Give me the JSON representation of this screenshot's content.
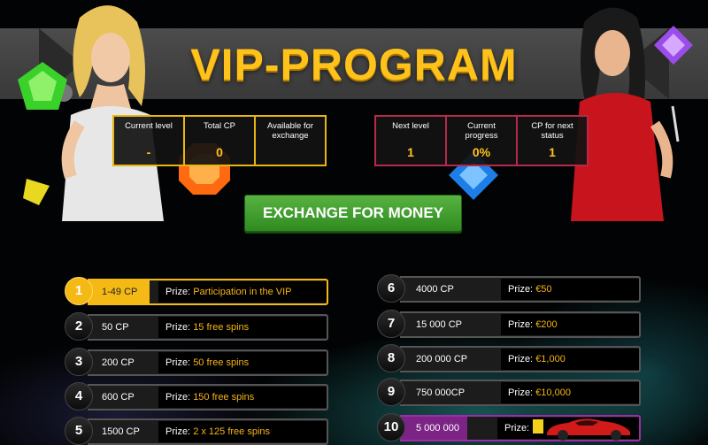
{
  "page": {
    "title": "VIP-PROGRAM",
    "exchange_button": "EXCHANGE FOR MONEY"
  },
  "stats_left": [
    {
      "label": "Current level",
      "value": "-"
    },
    {
      "label": "Total CP",
      "value": "0"
    },
    {
      "label": "Available for exchange",
      "value": ""
    }
  ],
  "stats_right": [
    {
      "label": "Next level",
      "value": "1"
    },
    {
      "label": "Current progress",
      "value": "0%"
    },
    {
      "label": "CP for next status",
      "value": "1"
    }
  ],
  "prize_label": "Prize:",
  "tiers_left": [
    {
      "num": "1",
      "cp": "1-49 CP",
      "prize": "Participation in the VIP"
    },
    {
      "num": "2",
      "cp": "50 CP",
      "prize": "15 free spins"
    },
    {
      "num": "3",
      "cp": "200 CP",
      "prize": "50 free spins"
    },
    {
      "num": "4",
      "cp": "600 CP",
      "prize": "150 free spins"
    },
    {
      "num": "5",
      "cp": "1500 CP",
      "prize": "2 x 125 free spins"
    }
  ],
  "tiers_right": [
    {
      "num": "6",
      "cp": "4000 CP",
      "prize": "€50"
    },
    {
      "num": "7",
      "cp": "15 000 CP",
      "prize": "€200"
    },
    {
      "num": "8",
      "cp": "200 000 CP",
      "prize": "€1,000"
    },
    {
      "num": "9",
      "cp": "750 000CP",
      "prize": "€10,000"
    },
    {
      "num": "10",
      "cp": "5 000 000 CP",
      "prize": ""
    }
  ],
  "colors": {
    "accent": "#ffc21a",
    "button": "#3fa02d",
    "right_border": "#b52a4a",
    "top_tier": "#7c2486"
  }
}
